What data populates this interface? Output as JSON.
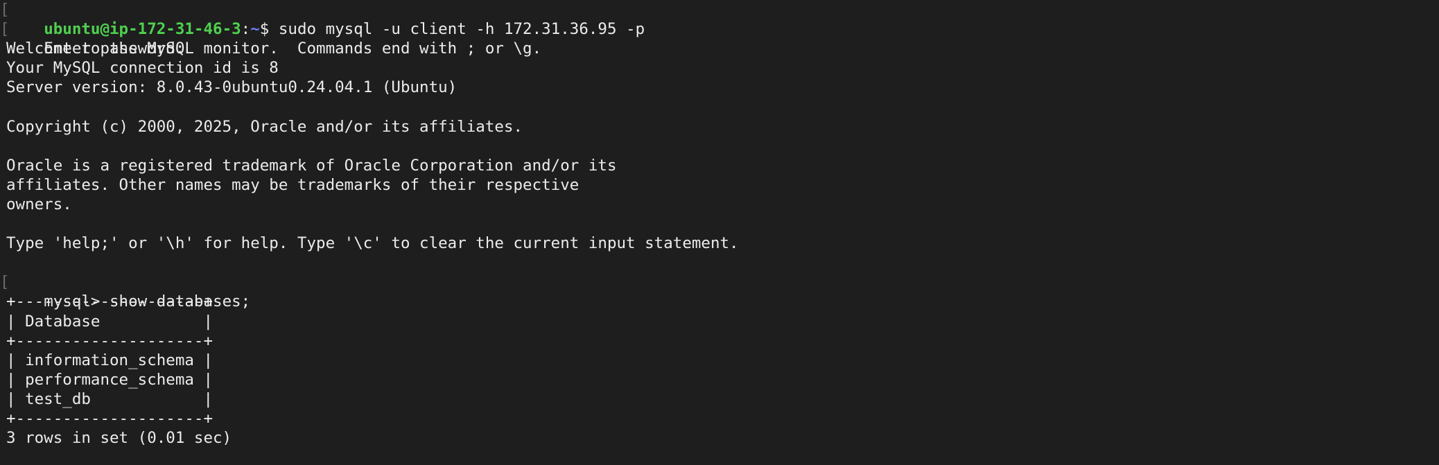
{
  "colors": {
    "background": "#1e1e1e",
    "foreground": "#ececec",
    "prompt_user": "#4fd04f",
    "prompt_path": "#6b7cff",
    "bracket": "#6b6b6b"
  },
  "shell": {
    "user_host": "ubuntu@ip-172-31-46-3",
    "colon": ":",
    "path": "~",
    "dollar": "$",
    "command": " sudo mysql -u client -h 172.31.36.95 -p"
  },
  "output": {
    "enter_password": "Enter password:",
    "welcome": "Welcome to the MySQL monitor.  Commands end with ; or \\g.",
    "connection_id": "Your MySQL connection id is 8",
    "server_version": "Server version: 8.0.43-0ubuntu0.24.04.1 (Ubuntu)",
    "copyright": "Copyright (c) 2000, 2025, Oracle and/or its affiliates.",
    "oracle_1": "Oracle is a registered trademark of Oracle Corporation and/or its",
    "oracle_2": "affiliates. Other names may be trademarks of their respective",
    "oracle_3": "owners.",
    "help_hint": "Type 'help;' or '\\h' for help. Type '\\c' to clear the current input statement."
  },
  "mysql": {
    "prompt": "mysql>",
    "command": " show databases;",
    "table_border": "+--------------------+",
    "table_header": "| Database           |",
    "rows": [
      "| information_schema |",
      "| performance_schema |",
      "| test_db            |"
    ],
    "result_summary": "3 rows in set (0.01 sec)"
  },
  "bracket_glyph": "["
}
